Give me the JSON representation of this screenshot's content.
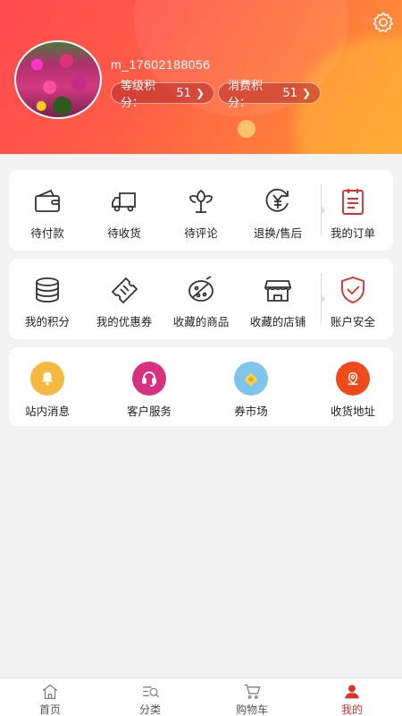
{
  "colors": {
    "accent": "#e0302e",
    "header_start": "#ff4a4f",
    "header_end": "#ff9a32"
  },
  "profile": {
    "username": "m_17602188056",
    "level_points_label": "等级积分：",
    "level_points_value": "51",
    "spend_points_label": "消费积分：",
    "spend_points_value": "51"
  },
  "orders": [
    {
      "label": "待付款",
      "icon": "wallet-icon"
    },
    {
      "label": "待收货",
      "icon": "truck-icon"
    },
    {
      "label": "待评论",
      "icon": "tulip-icon"
    },
    {
      "label": "退换/售后",
      "icon": "yen-refund-icon"
    },
    {
      "label": "我的订单",
      "icon": "order-list-icon"
    }
  ],
  "assets": [
    {
      "label": "我的积分",
      "icon": "coin-stack-icon"
    },
    {
      "label": "我的优惠券",
      "icon": "ticket-icon"
    },
    {
      "label": "收藏的商品",
      "icon": "favorite-goods-icon"
    },
    {
      "label": "收藏的店铺",
      "icon": "store-icon"
    },
    {
      "label": "账户安全",
      "icon": "shield-check-icon"
    }
  ],
  "services": [
    {
      "label": "站内消息",
      "icon": "bell-icon",
      "color": "#f5b840"
    },
    {
      "label": "客户服务",
      "icon": "headset-icon",
      "color": "#d8307e"
    },
    {
      "label": "券市场",
      "icon": "coupon-market-icon",
      "color": "#7ec4ec"
    },
    {
      "label": "收货地址",
      "icon": "location-icon",
      "color": "#f04a1c"
    }
  ],
  "tabs": [
    {
      "label": "首页",
      "icon": "home-icon"
    },
    {
      "label": "分类",
      "icon": "category-search-icon"
    },
    {
      "label": "购物车",
      "icon": "cart-icon"
    },
    {
      "label": "我的",
      "icon": "user-icon",
      "active": true
    }
  ]
}
